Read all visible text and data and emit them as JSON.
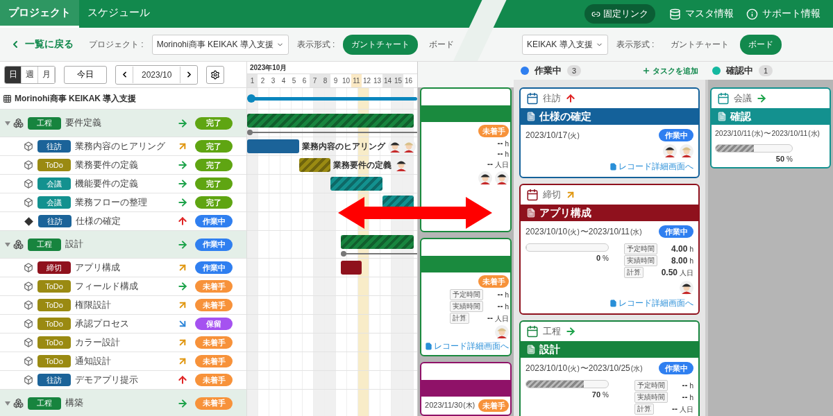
{
  "top_bar": {
    "tabs": [
      {
        "label": "プロジェクト",
        "selected": true
      },
      {
        "label": "スケジュール",
        "selected": false
      }
    ],
    "fixed_link": "固定リンク",
    "menu": [
      {
        "label": "マスタ情報",
        "kind": "database"
      },
      {
        "label": "サポート情報",
        "kind": "info"
      }
    ]
  },
  "gantt_view": {
    "toolbar": {
      "back": "一覧に戻る",
      "project_label": "プロジェクト :",
      "project": "Morinohi商事 KEIKAK 導入支援",
      "view_label": "表示形式 :",
      "view_tabs": [
        {
          "label": "ガントチャート",
          "selected": true
        },
        {
          "label": "ボード",
          "selected": false
        }
      ]
    },
    "scale_tabs": [
      {
        "label": "日",
        "selected": true
      },
      {
        "label": "週",
        "selected": false
      },
      {
        "label": "月",
        "selected": false
      }
    ],
    "today_button": "今日",
    "period": "2023/10",
    "project_title": "Morinohi商事 KEIKAK 導入支援",
    "month": "2023年10月",
    "days": [
      {
        "label": "1",
        "kind": "weekend"
      },
      {
        "label": "2",
        "kind": "plain"
      },
      {
        "label": "3",
        "kind": "plain"
      },
      {
        "label": "4",
        "kind": "plain"
      },
      {
        "label": "5",
        "kind": "plain"
      },
      {
        "label": "6",
        "kind": "plain"
      },
      {
        "label": "7",
        "kind": "weekend"
      },
      {
        "label": "8",
        "kind": "weekend"
      },
      {
        "label": "9",
        "kind": "plain"
      },
      {
        "label": "10",
        "kind": "plain"
      },
      {
        "label": "11",
        "kind": "today"
      },
      {
        "label": "12",
        "kind": "plain"
      },
      {
        "label": "13",
        "kind": "plain"
      },
      {
        "label": "14",
        "kind": "weekend"
      },
      {
        "label": "15",
        "kind": "weekend"
      },
      {
        "label": "16",
        "kind": "plain"
      }
    ],
    "groups": [
      {
        "type": {
          "label": "工程",
          "color": "#17843e"
        },
        "name": "要件定義",
        "priority": {
          "kind": "normal"
        },
        "status": {
          "label": "完了",
          "color": "#5fa512"
        },
        "expanded": true,
        "bar": {
          "kind": "hatched"
        },
        "children": [
          {
            "kind": "task",
            "type": {
              "label": "往訪",
              "color": "#1b6399"
            },
            "name": "業務内容のヒアリング",
            "priority": {
              "kind": "high"
            },
            "status": {
              "label": "完了",
              "color": "#5fa512"
            },
            "bar": {
              "kind": "solid",
              "label": "業務内容のヒアリング"
            },
            "assignees": [
              {
                "kind": "dark-hat"
              },
              {
                "kind": "straw-hat"
              }
            ]
          },
          {
            "kind": "task",
            "type": {
              "label": "ToDo",
              "color": "#9a8a12"
            },
            "name": "業務要件の定義",
            "priority": {
              "kind": "normal"
            },
            "status": {
              "label": "完了",
              "color": "#5fa512"
            },
            "bar": {
              "kind": "hatched",
              "label": "業務要件の定義"
            },
            "assignees": [
              {
                "kind": "dark-hat"
              }
            ]
          },
          {
            "kind": "task",
            "type": {
              "label": "会議",
              "color": "#13918f"
            },
            "name": "機能要件の定義",
            "priority": {
              "kind": "normal"
            },
            "status": {
              "label": "完了",
              "color": "#5fa512"
            },
            "bar": {
              "kind": "hatched"
            }
          },
          {
            "kind": "task",
            "type": {
              "label": "会議",
              "color": "#13918f"
            },
            "name": "業務フローの整理",
            "priority": {
              "kind": "normal"
            },
            "status": {
              "label": "完了",
              "color": "#5fa512"
            },
            "bar": {
              "kind": "hatched"
            }
          },
          {
            "kind": "milestone",
            "type": {
              "label": "往訪",
              "color": "#1b6399"
            },
            "name": "仕様の確定",
            "priority": {
              "kind": "highest"
            },
            "status": {
              "label": "作業中",
              "color": "#2f7ff0"
            }
          }
        ]
      },
      {
        "type": {
          "label": "工程",
          "color": "#17843e"
        },
        "name": "設計",
        "priority": {
          "kind": "normal"
        },
        "status": {
          "label": "作業中",
          "color": "#2f7ff0"
        },
        "expanded": true,
        "bar": {
          "kind": "hatched"
        },
        "children": [
          {
            "kind": "task",
            "type": {
              "label": "締切",
              "color": "#8f111d"
            },
            "name": "アプリ構成",
            "priority": {
              "kind": "high"
            },
            "status": {
              "label": "作業中",
              "color": "#2f7ff0"
            },
            "bar": {
              "kind": "solid"
            }
          },
          {
            "kind": "task",
            "type": {
              "label": "ToDo",
              "color": "#9a8a12"
            },
            "name": "フィールド構成",
            "priority": {
              "kind": "normal"
            },
            "status": {
              "label": "未着手",
              "color": "#f7923a"
            }
          },
          {
            "kind": "task",
            "type": {
              "label": "ToDo",
              "color": "#9a8a12"
            },
            "name": "権限設計",
            "priority": {
              "kind": "high"
            },
            "status": {
              "label": "未着手",
              "color": "#f7923a"
            }
          },
          {
            "kind": "task",
            "type": {
              "label": "ToDo",
              "color": "#9a8a12"
            },
            "name": "承認プロセス",
            "priority": {
              "kind": "low"
            },
            "status": {
              "label": "保留",
              "color": "#a552f0"
            }
          },
          {
            "kind": "task",
            "type": {
              "label": "ToDo",
              "color": "#9a8a12"
            },
            "name": "カラー設計",
            "priority": {
              "kind": "high"
            },
            "status": {
              "label": "未着手",
              "color": "#f7923a"
            }
          },
          {
            "kind": "task",
            "type": {
              "label": "ToDo",
              "color": "#9a8a12"
            },
            "name": "通知設計",
            "priority": {
              "kind": "high"
            },
            "status": {
              "label": "未着手",
              "color": "#f7923a"
            }
          },
          {
            "kind": "task",
            "type": {
              "label": "往訪",
              "color": "#1b6399"
            },
            "name": "デモアプリ提示",
            "priority": {
              "kind": "highest"
            },
            "status": {
              "label": "未着手",
              "color": "#f7923a"
            }
          }
        ]
      },
      {
        "type": {
          "label": "工程",
          "color": "#17843e"
        },
        "name": "構築",
        "priority": {
          "kind": "normal"
        },
        "status": {
          "label": "未着手",
          "color": "#f7923a"
        },
        "expanded": true
      }
    ]
  },
  "board_partial_column": {
    "cards": [
      {
        "color": "#1a8a3e",
        "status": {
          "label": "未着手",
          "color": "#f7923a"
        },
        "metrics": [
          {
            "value": "--",
            "unit": "h"
          },
          {
            "value": "--",
            "unit": "h"
          },
          {
            "value": "--",
            "unit": "人日"
          }
        ],
        "assignees": [
          {
            "kind": "dark-hat"
          },
          {
            "kind": "dark-hat"
          }
        ]
      },
      {
        "color": "#1a8a3e",
        "status": {
          "label": "未着手",
          "color": "#f7923a"
        },
        "metrics": [
          {
            "label": "予定時間",
            "value": "--",
            "unit": "h"
          },
          {
            "label": "実績時間",
            "value": "--",
            "unit": "h"
          },
          {
            "label": "計算",
            "value": "--",
            "unit": "人日"
          }
        ],
        "assignees": [
          {
            "kind": "straw-hat"
          }
        ],
        "link": "レコード詳細画面へ"
      },
      {
        "color": "#8f1268",
        "date": "2023/11/30",
        "weekday": "(木)",
        "status": {
          "label": "未着手",
          "color": "#f7923a"
        }
      }
    ]
  },
  "board_view": {
    "toolbar": {
      "project": "KEIKAK 導入支援",
      "view_label": "表示形式 :",
      "view_tabs": [
        {
          "label": "ガントチャート",
          "selected": false
        },
        {
          "label": "ボード",
          "selected": true
        }
      ]
    },
    "columns": [
      {
        "name": "作業中",
        "color": "#2f7ff0",
        "count": "3",
        "add_task": "タスクを追加",
        "cards": [
          {
            "type": "往訪",
            "color": "#14619a",
            "priority": {
              "kind": "highest"
            },
            "title": "仕様の確定",
            "dates": [
              {
                "date": "2023/10/17",
                "weekday": "(火)"
              }
            ],
            "status": {
              "label": "作業中",
              "color": "#2f7ff0"
            },
            "assignees": [
              {
                "kind": "dark-hat"
              },
              {
                "kind": "straw-hat"
              }
            ],
            "link": "レコード詳細画面へ"
          },
          {
            "type": "締切",
            "color": "#8f111d",
            "priority": {
              "kind": "high"
            },
            "title": "アプリ構成",
            "dates": [
              {
                "date": "2023/10/10",
                "weekday": "(火)"
              },
              {
                "date": "2023/10/11",
                "weekday": "(水)"
              }
            ],
            "separator": "〜",
            "status": {
              "label": "作業中",
              "color": "#2f7ff0"
            },
            "progress": {
              "level": 0,
              "reading": "0",
              "unit": "%"
            },
            "metrics": [
              {
                "label": "予定時間",
                "value": "4.00",
                "unit": "h"
              },
              {
                "label": "実績時間",
                "value": "8.00",
                "unit": "h"
              },
              {
                "label": "計算",
                "value": "0.50",
                "unit": "人日"
              }
            ],
            "assignees": [
              {
                "kind": "dark-hat"
              }
            ],
            "link": "レコード詳細画面へ"
          },
          {
            "type": "工程",
            "color": "#17843e",
            "priority": {
              "kind": "normal"
            },
            "title": "設計",
            "dates": [
              {
                "date": "2023/10/10",
                "weekday": "(火)"
              },
              {
                "date": "2023/10/25",
                "weekday": "(水)"
              }
            ],
            "separator": "〜",
            "status": {
              "label": "作業中",
              "color": "#2f7ff0"
            },
            "progress": {
              "level": 0.7,
              "reading": "70",
              "unit": "%"
            },
            "metrics": [
              {
                "label": "予定時間",
                "value": "--",
                "unit": "h"
              },
              {
                "label": "実績時間",
                "value": "--",
                "unit": "h"
              },
              {
                "label": "計算",
                "value": "--",
                "unit": "人日"
              }
            ]
          }
        ]
      },
      {
        "name": "確認中",
        "color": "#14b8a0",
        "count": "1",
        "cards": [
          {
            "type": "会議",
            "color": "#13918f",
            "priority": {
              "kind": "normal"
            },
            "title": "確認",
            "dates": [
              {
                "date": "2023/10/11",
                "weekday": "(水)"
              },
              {
                "date": "2023/10/11",
                "weekday": "(水)"
              }
            ],
            "separator": "〜",
            "progress": {
              "level": 0.5,
              "reading": "50",
              "unit": "%"
            }
          }
        ]
      }
    ]
  }
}
